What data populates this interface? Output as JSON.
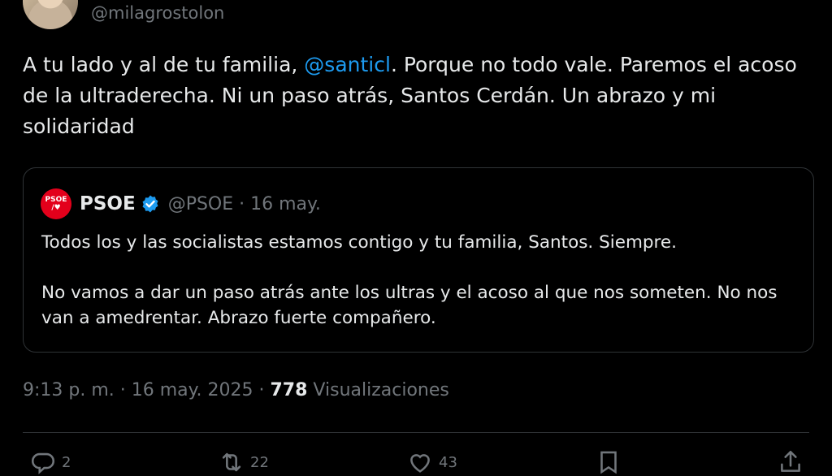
{
  "author": {
    "handle": "@milagrostolon"
  },
  "tweet": {
    "text_before": "A tu lado y al de tu familia, ",
    "mention": "@santicl",
    "text_after": ". Porque no todo vale. Paremos el acoso de la ultraderecha. Ni un paso atrás, Santos Cerdán. Un abrazo y mi solidaridad"
  },
  "quoted": {
    "logo_text_top": "PSOE",
    "logo_text_bottom": "/♥",
    "name": "PSOE",
    "meta": "@PSOE · 16 may.",
    "paragraph1": "Todos los y las socialistas estamos contigo y tu familia, Santos. Siempre.",
    "paragraph2": "No vamos a dar un paso atrás ante los ultras y el acoso al que nos someten. No nos van a amedrentar. Abrazo fuerte compañero."
  },
  "meta": {
    "timestamp": "9:13 p. m. · 16 may. 2025 · ",
    "views_count": "778",
    "views_label": " Visualizaciones"
  },
  "actions": {
    "reply_count": "2",
    "retweet_count": "22",
    "like_count": "43"
  },
  "colors": {
    "accent": "#1d9bf0",
    "background": "#000000",
    "muted": "#71767b",
    "psoe_red": "#e3001b"
  }
}
